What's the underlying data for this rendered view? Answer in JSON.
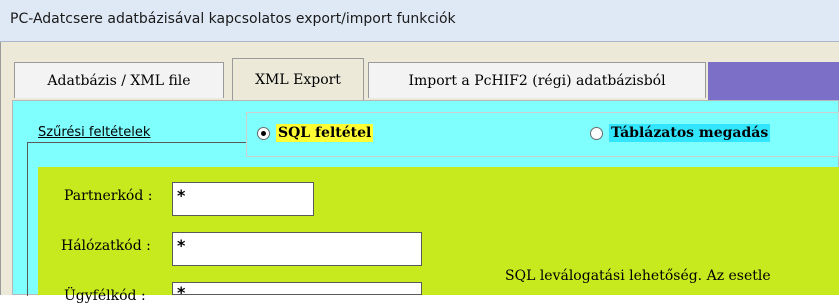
{
  "window": {
    "title": "PC-Adatcsere adatbázisával kapcsolatos export/import funkciók"
  },
  "tabs": [
    {
      "label": "Adatbázis / XML file",
      "active": false
    },
    {
      "label": "XML Export",
      "active": true
    },
    {
      "label": "Import a PcHIF2 (régi) adatbázisból",
      "active": false
    }
  ],
  "filter_group": {
    "label": "Szűrési feltételek"
  },
  "mode_radio": {
    "options": [
      {
        "label": "SQL feltétel",
        "selected": true
      },
      {
        "label": "Táblázatos megadás",
        "selected": false
      }
    ]
  },
  "fields": [
    {
      "label": "Partnerkód :",
      "value": "*"
    },
    {
      "label": "Hálózatkód :",
      "value": "*"
    },
    {
      "label": "Ügyfélkód :",
      "value": "*"
    }
  ],
  "info_text": "SQL leválogatási lehetőség. Az esetle",
  "colors": {
    "panel_bg": "#80ffff",
    "content_bg": "#c6ea1e",
    "tab_fill": "#7b6fc8",
    "highlight_selected": "#ffff33",
    "highlight_unselected": "#33e6ff"
  }
}
